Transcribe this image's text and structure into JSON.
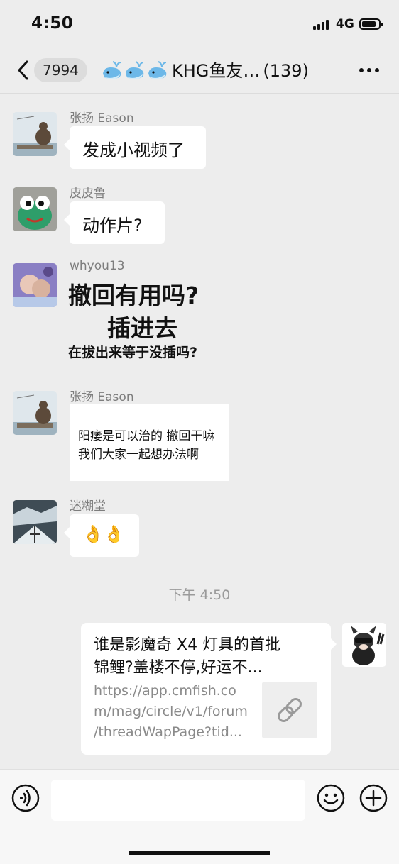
{
  "status_bar": {
    "time": "4:50",
    "network": "4G"
  },
  "nav": {
    "unread_count": "7994",
    "group_name": "KHG鱼友…",
    "member_count": "(139)"
  },
  "messages": [
    {
      "sender": "张扬 Eason",
      "text": "发成小视频了"
    },
    {
      "sender": "皮皮鲁",
      "text": "动作片?"
    },
    {
      "sender": "whyou13",
      "sticker_lines": [
        "撤回有用吗?",
        "插进去",
        "在拔出来等于没插吗?"
      ]
    },
    {
      "sender": "张扬 Eason",
      "image_lines": [
        "阳痿是可以治的 撤回干嘛",
        "我们大家一起想办法啊"
      ]
    },
    {
      "sender": "迷糊堂",
      "text": "👌👌"
    }
  ],
  "timestamp": "下午 4:50",
  "link_card": {
    "title_lines": [
      "谁是影魔奇 X4 灯具的首批",
      "锦鲤?盖楼不停,好运不..."
    ],
    "url_lines": [
      "https://app.cmfish.co",
      "m/mag/circle/v1/forum",
      "/threadWapPage?tid..."
    ],
    "thumb_icon": "link-icon"
  },
  "input_bar": {
    "voice_icon": "voice-icon",
    "emoji_icon": "emoji-icon",
    "plus_icon": "plus-icon"
  }
}
